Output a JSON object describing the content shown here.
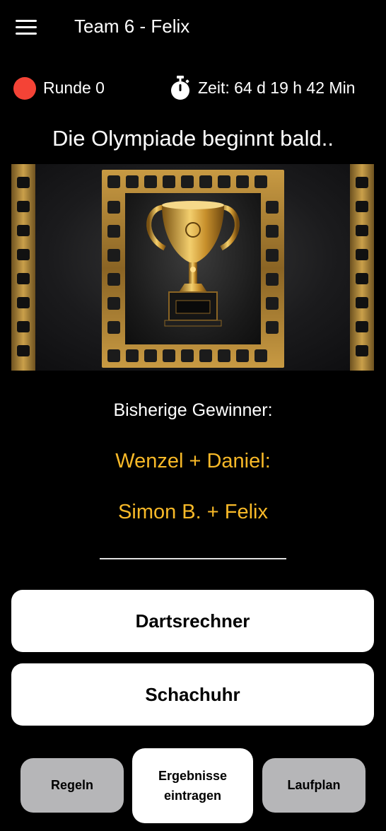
{
  "header": {
    "title": "Team 6 - Felix",
    "menu_icon": "hamburger-menu-icon"
  },
  "status": {
    "round_label": "Runde 0",
    "round_indicator_color": "#f44336",
    "timer_icon": "stopwatch-icon",
    "time_label": "Zeit: 64 d 19 h 42 Min"
  },
  "main": {
    "headline": "Die Olympiade beginnt bald..",
    "hero_image": "golden-trophy-film-frame-image",
    "winners_heading": "Bisherige Gewinner:",
    "winners": [
      "Wenzel + Daniel:",
      "Simon B. + Felix"
    ],
    "winner_color": "#f8b928"
  },
  "actions": {
    "darts_label": "Dartsrechner",
    "chess_clock_label": "Schachuhr"
  },
  "bottom_nav": {
    "rules_label": "Regeln",
    "results_label_line1": "Ergebnisse",
    "results_label_line2": "eintragen",
    "schedule_label": "Laufplan"
  }
}
